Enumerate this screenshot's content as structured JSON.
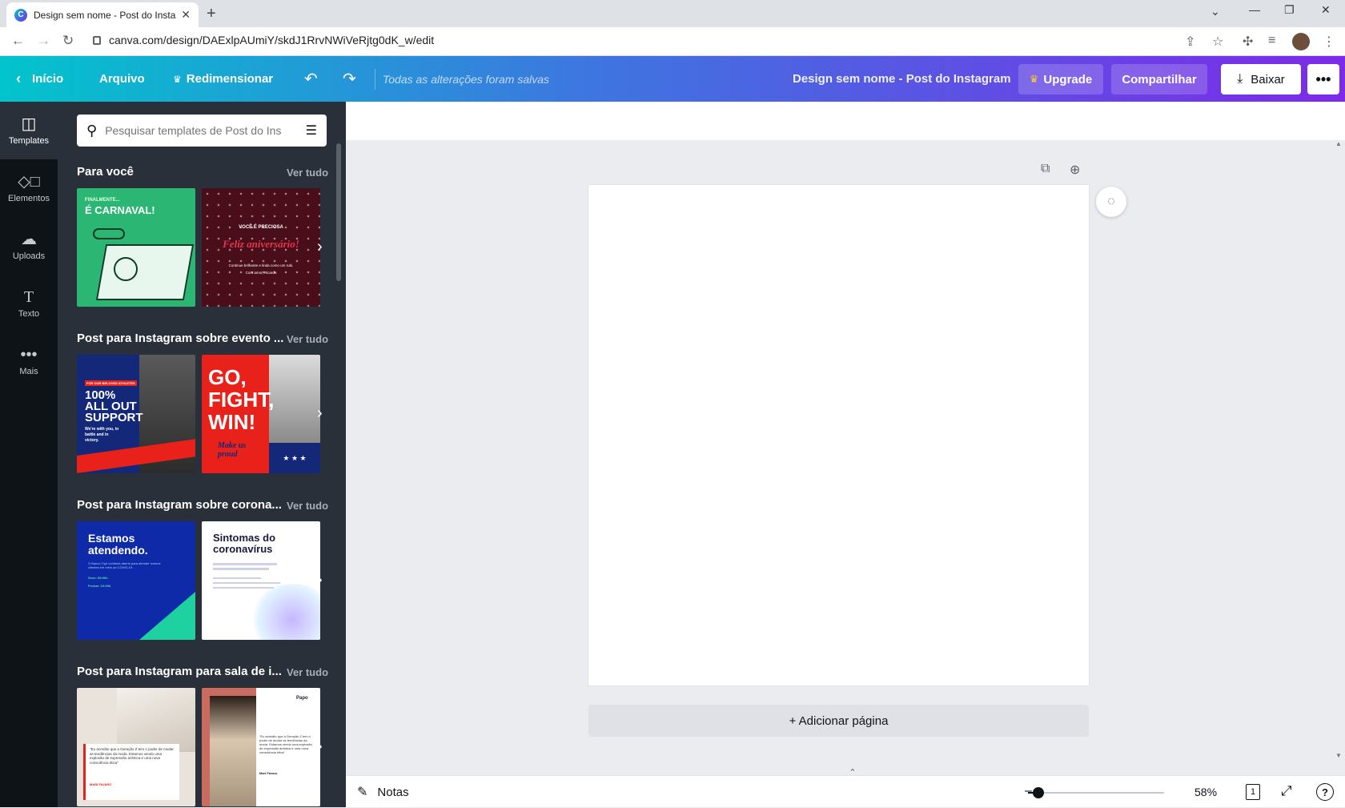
{
  "browser": {
    "tab_title": "Design sem nome - Post do Insta",
    "url": "canva.com/design/DAExlpAUmiY/skdJ1RrvNWiVeRjtg0dK_w/edit"
  },
  "topbar": {
    "back_label": "Início",
    "file_label": "Arquivo",
    "resize_label": "Redimensionar",
    "saved_status": "Todas as alterações foram salvas",
    "doc_title": "Design sem nome - Post do Instagram",
    "upgrade_label": "Upgrade",
    "share_label": "Compartilhar",
    "download_label": "Baixar"
  },
  "rail": {
    "items": [
      {
        "label": "Templates",
        "icon": "templates-icon"
      },
      {
        "label": "Elementos",
        "icon": "elements-icon"
      },
      {
        "label": "Uploads",
        "icon": "upload-icon"
      },
      {
        "label": "Texto",
        "icon": "text-icon"
      },
      {
        "label": "Mais",
        "icon": "more-icon"
      }
    ]
  },
  "panel": {
    "search_placeholder": "Pesquisar templates de Post do Ins",
    "see_all": "Ver tudo",
    "sections": [
      {
        "title": "Para você",
        "thumbs": [
          {
            "lines": [
              "FINALMENTE...",
              "É CARNAVAL!"
            ],
            "bg": "#2bb673"
          },
          {
            "lines": [
              "VOCÊ É PRECIOSA",
              "Feliz aniversário!",
              "Continue brilhante e linda como um rubi.",
              "Com amor, Ricardo"
            ],
            "bg": "#4a0d1a"
          }
        ]
      },
      {
        "title": "Post para Instagram sobre evento ...",
        "thumbs": [
          {
            "lines": [
              "FOR OUR BELOVED ATHLETES",
              "100%",
              "ALL OUT",
              "SUPPORT",
              "We're with you, in",
              "battle and in",
              "victory."
            ],
            "bg": "#14287a"
          },
          {
            "lines": [
              "GO,",
              "FIGHT,",
              "WIN!",
              "Make us proud"
            ],
            "bg": "#e8221b"
          }
        ]
      },
      {
        "title": "Post para Instagram sobre corona...",
        "thumbs": [
          {
            "lines": [
              "Estamos",
              "atendendo.",
              "O Banco Tupi continua aberto para atender nossos clientes em meio ao COVID-19.",
              "Seeu: 08:00h",
              "Fechar: 16:00h"
            ],
            "bg": "#0f2aa8"
          },
          {
            "lines": [
              "Sintomas do",
              "coronavírus"
            ],
            "bg": "#ffffff"
          }
        ]
      },
      {
        "title": "Post para Instagram para sala de i...",
        "thumbs": [
          {
            "lines": [
              "\"Eu acredito que a Geração Z tem o poder de mudar as tendências da moda. Estamos vendo uma explosão de expressão artística e uma nova consciência ética\"",
              "MARI FAVARO"
            ],
            "bg": "#e9e3dc"
          },
          {
            "lines": [
              "Papo",
              "\"Eu acredito que a Geração Z tem o poder de mudar as tendências da moda. Estamos vendo uma explosão de expressão artística e uma nova consciência ética\"",
              "Mari Favaro"
            ],
            "bg": "#c96b5e"
          }
        ]
      }
    ]
  },
  "canvas": {
    "add_page_label": "+ Adicionar página"
  },
  "bottombar": {
    "notes_label": "Notas",
    "zoom_value": "58%",
    "zoom_fraction": 0.58,
    "page_count": "1"
  }
}
